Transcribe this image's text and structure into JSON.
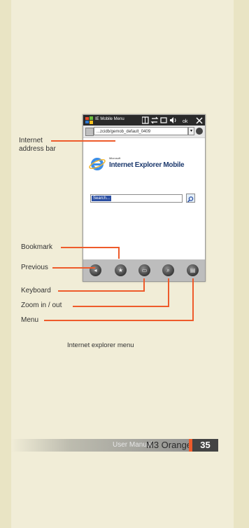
{
  "phone": {
    "title_text": "IE Mobile Menu",
    "address_text": "...zcidb/gemob_default_0409",
    "search_text": "Search...",
    "brand_small": "Microsoft",
    "brand": "Internet Explorer Mobile"
  },
  "callouts": {
    "address_bar_line1": "Internet",
    "address_bar_line2": "address bar",
    "bookmark": "Bookmark",
    "previous": "Previous",
    "keyboard": "Keyboard",
    "zoom": "Zoom in / out",
    "menu": "Menu"
  },
  "caption": "Internet explorer menu",
  "footer": {
    "manual_label": "User Manual",
    "model": "M3 Orange",
    "page_number": "35"
  },
  "colors": {
    "accent": "#ee5b2b",
    "page_bg": "#e9e4c4",
    "panel_bg": "#f1edd7",
    "page_box": "#444444"
  },
  "icons": [
    "windows-logo-icon",
    "ie-logo-icon",
    "search-go-icon",
    "previous-icon",
    "bookmark-icon",
    "keyboard-icon",
    "zoom-icon",
    "menu-icon"
  ]
}
